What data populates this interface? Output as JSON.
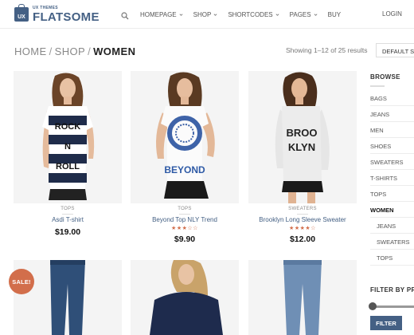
{
  "brand": {
    "subtitle": "UX THEMES",
    "name": "FLATSOME",
    "box_letters": "UX",
    "color": "#446084"
  },
  "nav": {
    "items": [
      {
        "label": "HOMEPAGE",
        "dropdown": true
      },
      {
        "label": "SHOP",
        "dropdown": true
      },
      {
        "label": "SHORTCODES",
        "dropdown": true
      },
      {
        "label": "PAGES",
        "dropdown": true
      },
      {
        "label": "BUY",
        "dropdown": false
      }
    ],
    "login": "LOGIN"
  },
  "breadcrumb": {
    "items": [
      "HOME",
      "SHOP"
    ],
    "separator": "/",
    "current": "WOMEN"
  },
  "results_text": "Showing 1–12 of 25 results",
  "sort_select": "DEFAULT S",
  "accent_color": "#d26e4b",
  "products": [
    {
      "category": "TOPS",
      "name": "Asdi T-shirt",
      "price": "$19.00",
      "rating": null
    },
    {
      "category": "TOPS",
      "name": "Beyond Top NLY Trend",
      "price": "$9.90",
      "rating": 3
    },
    {
      "category": "SWEATERS",
      "name": "Brooklyn Long Sleeve Sweater",
      "price": "$12.00",
      "rating": 4
    },
    {
      "category": "",
      "name": "",
      "price": "",
      "rating": null,
      "sale": "SALE!"
    },
    {
      "category": "",
      "name": "",
      "price": "",
      "rating": null
    },
    {
      "category": "",
      "name": "",
      "price": "",
      "rating": null
    }
  ],
  "shirt_prints": {
    "p1": [
      "ROCK",
      "N",
      "ROLL"
    ],
    "p2": "BEYOND",
    "p3": [
      "BROO",
      "KLYN"
    ]
  },
  "sidebar": {
    "browse_title": "BROWSE",
    "categories": [
      {
        "label": "BAGS",
        "active": false,
        "sub": false
      },
      {
        "label": "JEANS",
        "active": false,
        "sub": false
      },
      {
        "label": "MEN",
        "active": false,
        "sub": false
      },
      {
        "label": "SHOES",
        "active": false,
        "sub": false
      },
      {
        "label": "SWEATERS",
        "active": false,
        "sub": false
      },
      {
        "label": "T-SHIRTS",
        "active": false,
        "sub": false
      },
      {
        "label": "TOPS",
        "active": false,
        "sub": false
      },
      {
        "label": "WOMEN",
        "active": true,
        "sub": false
      },
      {
        "label": "JEANS",
        "active": false,
        "sub": true
      },
      {
        "label": "SWEATERS",
        "active": false,
        "sub": true
      },
      {
        "label": "TOPS",
        "active": false,
        "sub": true
      }
    ],
    "filter_title": "FILTER BY PRIC",
    "filter_button": "FILTER"
  }
}
